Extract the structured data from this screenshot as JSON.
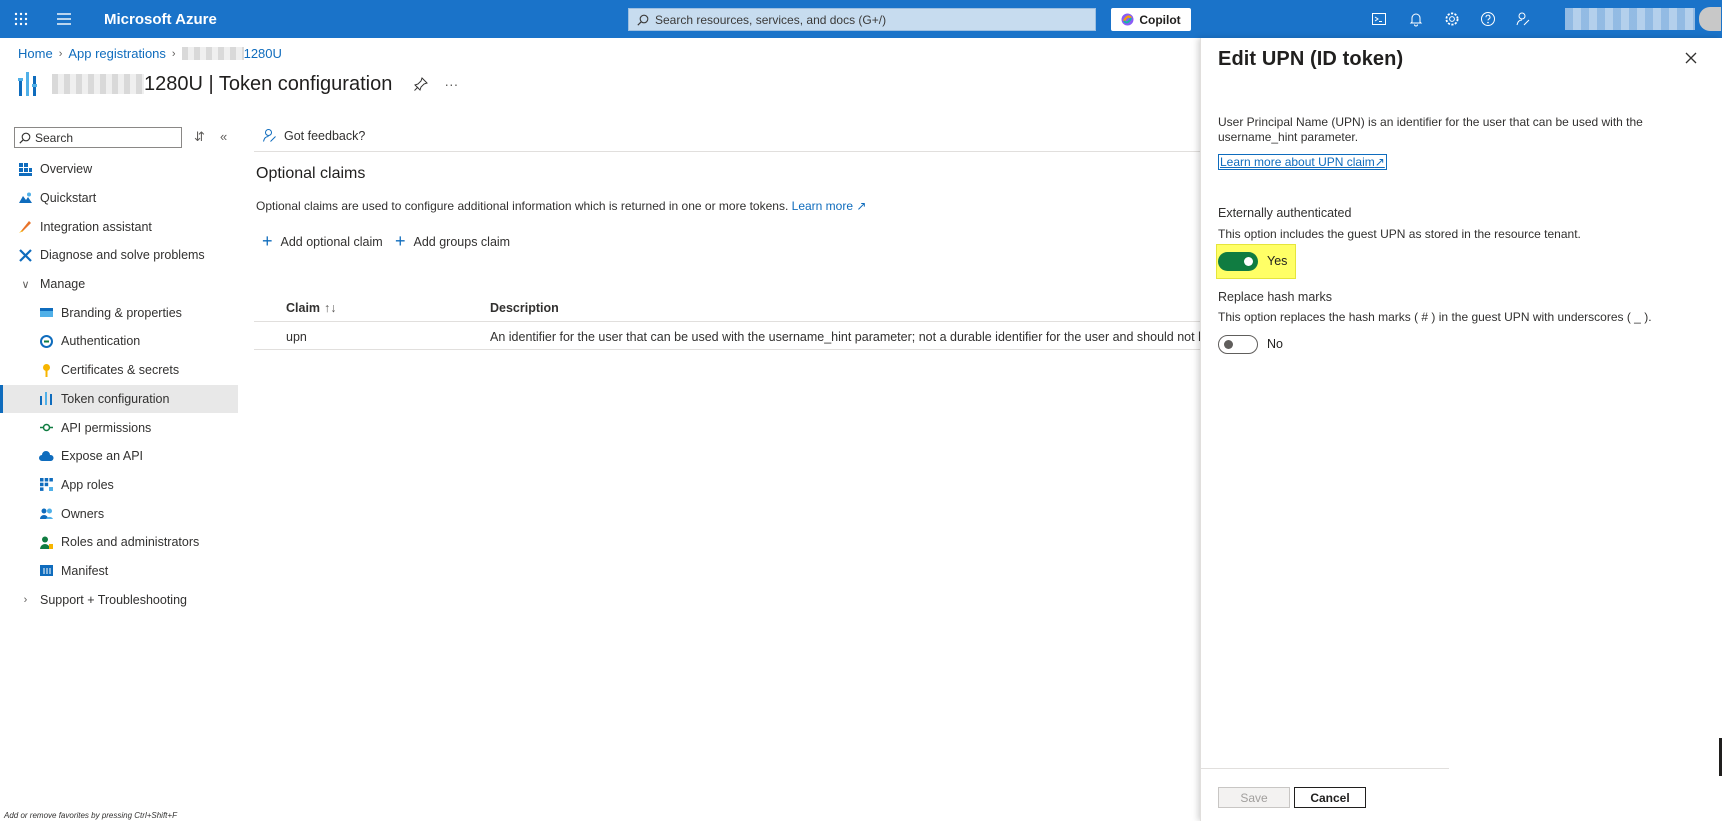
{
  "topbar": {
    "brand": "Microsoft Azure",
    "search_placeholder": "Search resources, services, and docs (G+/)",
    "copilot_label": "Copilot"
  },
  "breadcrumb": {
    "home": "Home",
    "app_registrations": "App registrations",
    "app_suffix": "1280U"
  },
  "page": {
    "title_suffix": "1280U | Token configuration",
    "more": "···"
  },
  "sidebar": {
    "search_placeholder": "Search",
    "items": [
      {
        "label": "Overview",
        "icon": "overview-icon"
      },
      {
        "label": "Quickstart",
        "icon": "quickstart-icon"
      },
      {
        "label": "Integration assistant",
        "icon": "rocket-icon"
      },
      {
        "label": "Diagnose and solve problems",
        "icon": "wrench-icon"
      },
      {
        "label": "Manage",
        "icon": "chevron-down-icon"
      },
      {
        "label": "Branding & properties",
        "icon": "branding-icon"
      },
      {
        "label": "Authentication",
        "icon": "authentication-icon"
      },
      {
        "label": "Certificates & secrets",
        "icon": "key-icon"
      },
      {
        "label": "Token configuration",
        "icon": "token-icon"
      },
      {
        "label": "API permissions",
        "icon": "api-permissions-icon"
      },
      {
        "label": "Expose an API",
        "icon": "cloud-icon"
      },
      {
        "label": "App roles",
        "icon": "app-roles-icon"
      },
      {
        "label": "Owners",
        "icon": "owners-icon"
      },
      {
        "label": "Roles and administrators",
        "icon": "roles-icon"
      },
      {
        "label": "Manifest",
        "icon": "manifest-icon"
      },
      {
        "label": "Support + Troubleshooting",
        "icon": "chevron-right-icon"
      }
    ],
    "footer_hint": "Add or remove favorites by pressing Ctrl+Shift+F"
  },
  "main": {
    "feedback": "Got feedback?",
    "section_title": "Optional claims",
    "section_desc": "Optional claims are used to configure additional information which is returned in one or more tokens.",
    "learn_more": "Learn more",
    "add_optional_claim": "Add optional claim",
    "add_groups_claim": "Add groups claim",
    "table": {
      "headers": [
        "Claim",
        "Description"
      ],
      "sort_glyph": "↑↓",
      "rows": [
        {
          "claim": "upn",
          "description": "An identifier for the user that can be used with the username_hint parameter; not a durable identifier for the user and should not be used t"
        }
      ]
    }
  },
  "panel": {
    "title": "Edit UPN (ID token)",
    "description": "User Principal Name (UPN) is an identifier for the user that can be used with the username_hint parameter.",
    "learn_more_link": "Learn more about UPN claim",
    "externally_authenticated": {
      "label": "Externally authenticated",
      "desc": "This option includes the guest UPN as stored in the resource tenant.",
      "value": "Yes"
    },
    "replace_hash_marks": {
      "label": "Replace hash marks",
      "desc": "This option replaces the hash marks ( # ) in the guest UPN with underscores ( _ ).",
      "value": "No"
    },
    "save_label": "Save",
    "cancel_label": "Cancel"
  },
  "colors": {
    "topbar": "#1a73c9",
    "link": "#0f6cbd",
    "toggle_on": "#107c41",
    "highlight": "#ffff66"
  }
}
